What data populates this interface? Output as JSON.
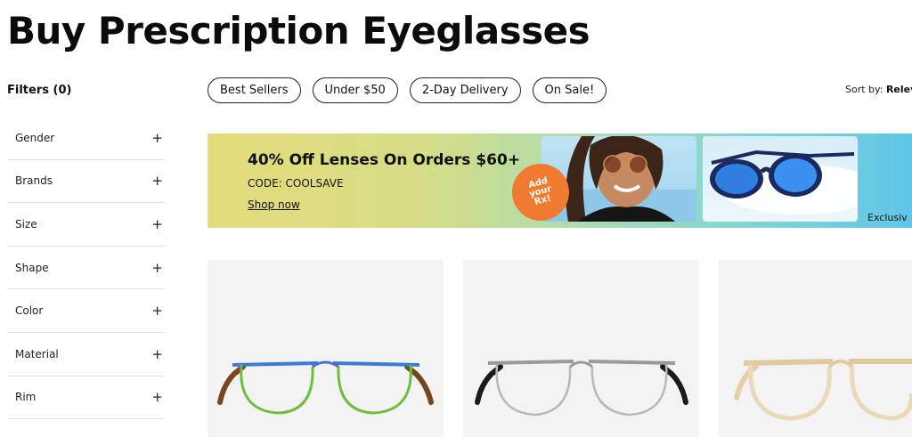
{
  "page": {
    "title": "Buy Prescription Eyeglasses"
  },
  "filters": {
    "heading": "Filters (0)",
    "items": [
      {
        "label": "Gender",
        "icon": "plus-icon"
      },
      {
        "label": "Brands",
        "icon": "plus-icon"
      },
      {
        "label": "Size",
        "icon": "plus-icon"
      },
      {
        "label": "Shape",
        "icon": "plus-icon"
      },
      {
        "label": "Color",
        "icon": "plus-icon"
      },
      {
        "label": "Material",
        "icon": "plus-icon"
      },
      {
        "label": "Rim",
        "icon": "plus-icon"
      }
    ],
    "expand_symbol": "+"
  },
  "quick_filters": [
    "Best Sellers",
    "Under $50",
    "2-Day Delivery",
    "On Sale!"
  ],
  "sort": {
    "label": "Sort by:",
    "value": "Relev"
  },
  "promo": {
    "headline": "40% Off Lenses On Orders $60+",
    "code": "CODE: COOLSAVE",
    "link": "Shop now",
    "badge_lines": [
      "Add",
      "your",
      "Rx!"
    ],
    "side_label": "Exclusiv",
    "colors": {
      "badge": "#f07a2e",
      "gradient_start": "#e4dc7a",
      "gradient_end": "#5fc6e8"
    }
  },
  "products": [
    {
      "frame_color": "multicolor green-blue",
      "temple_color": "tortoise"
    },
    {
      "frame_color": "silver",
      "temple_color": "black"
    },
    {
      "frame_color": "clear beige",
      "temple_color": "beige"
    }
  ]
}
